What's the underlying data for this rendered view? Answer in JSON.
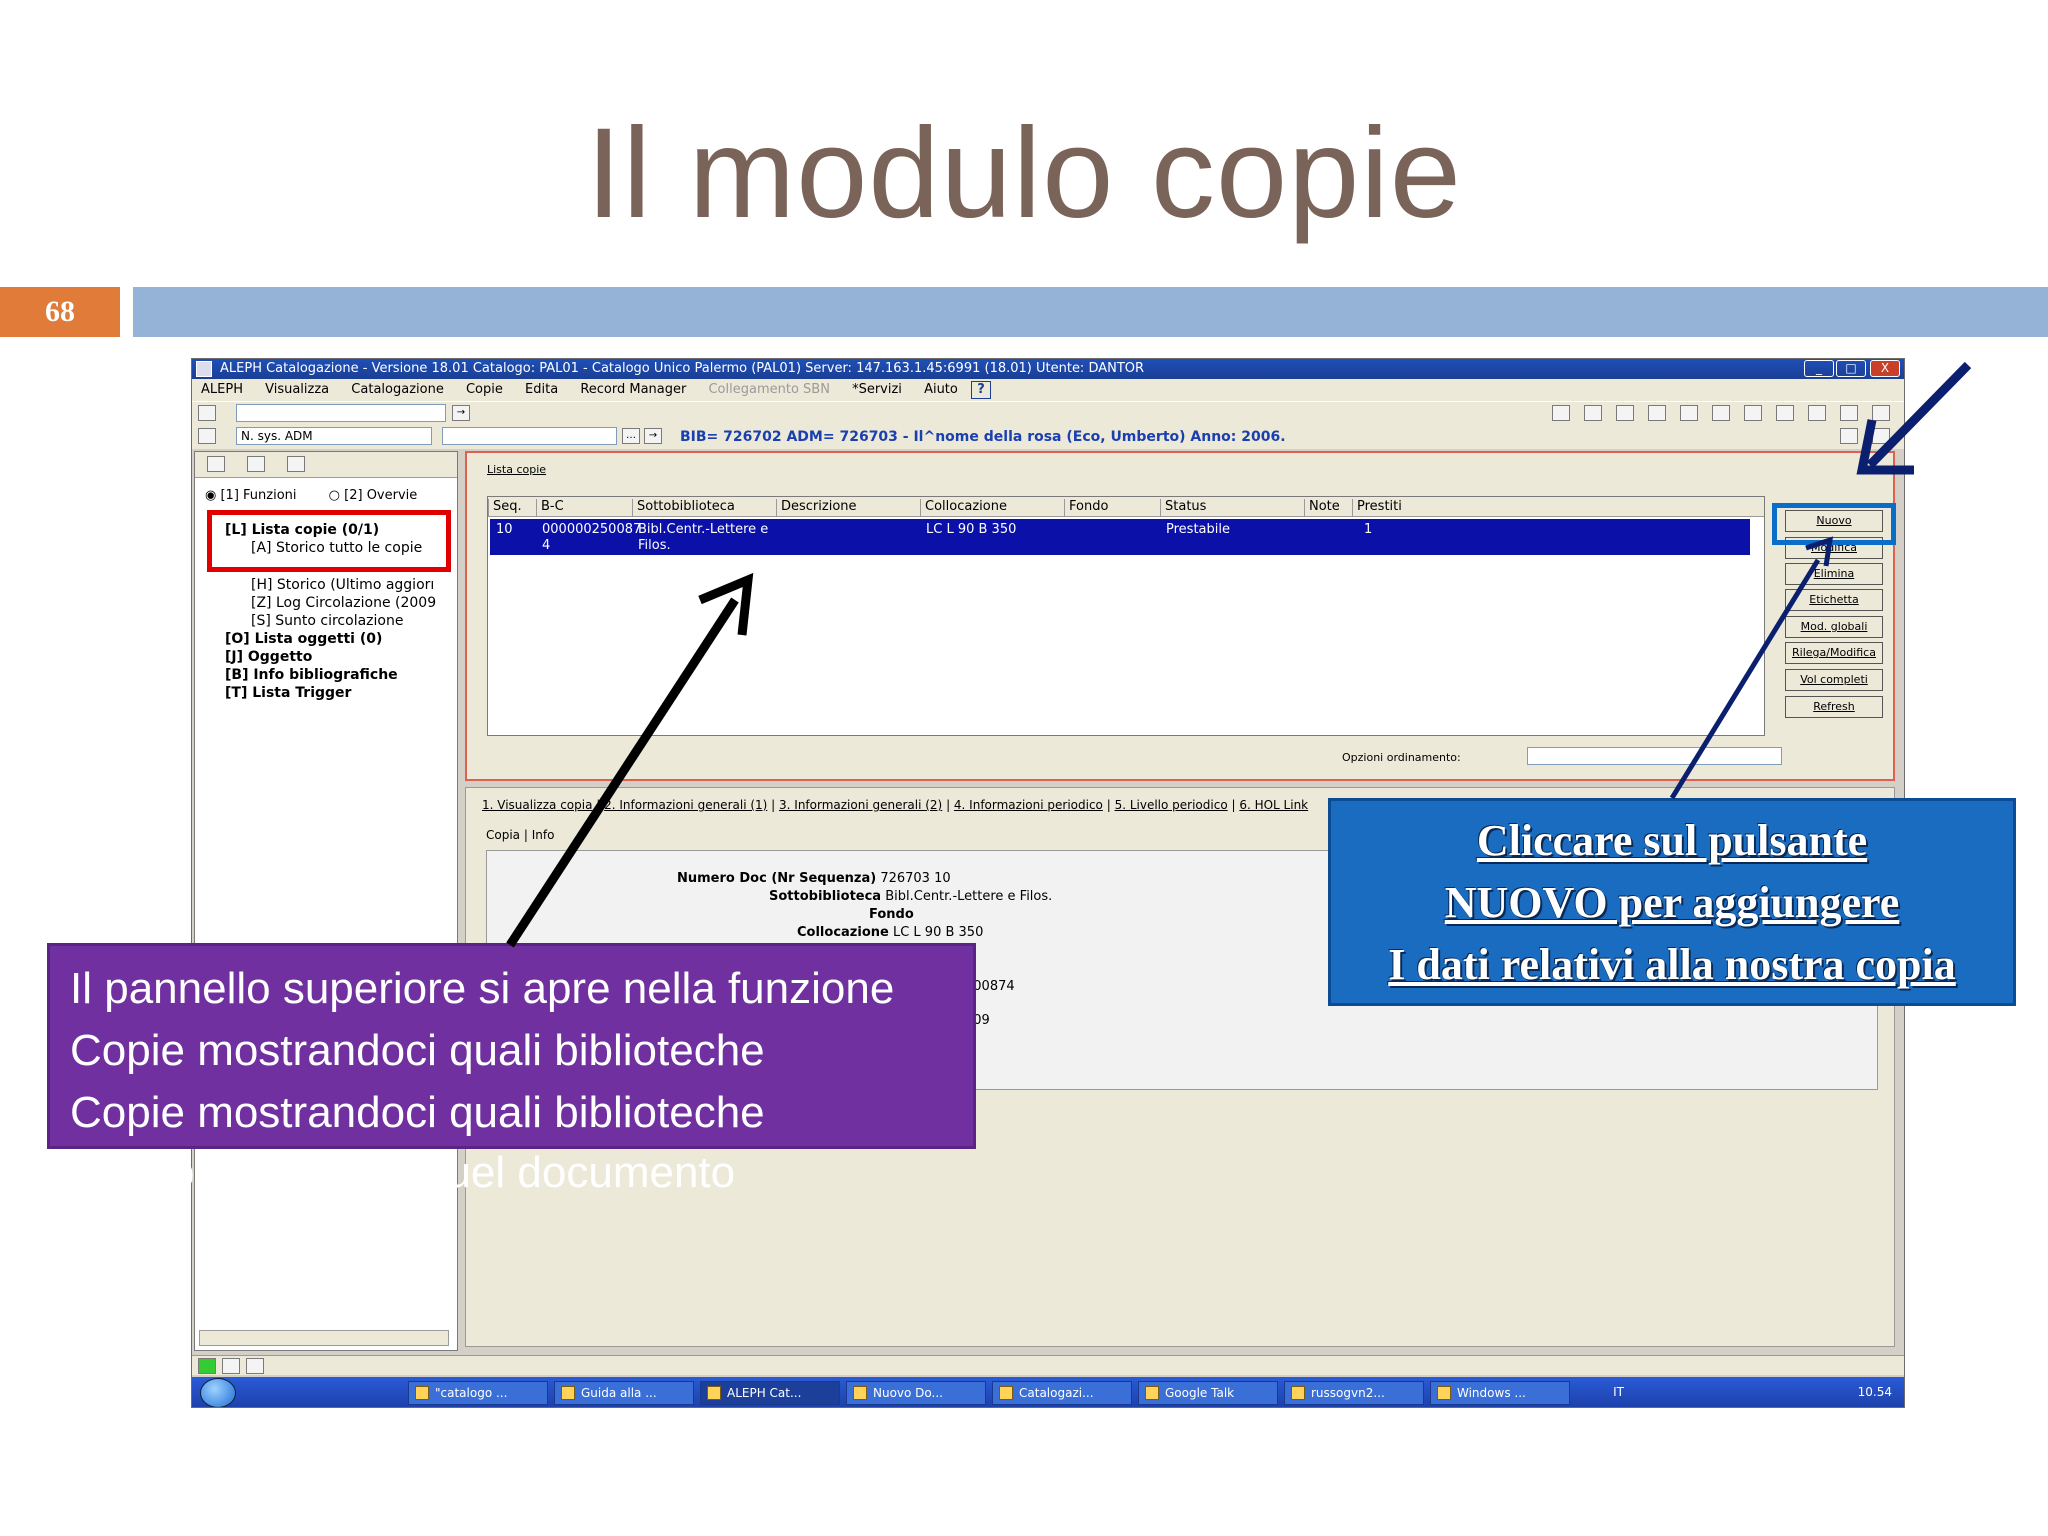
{
  "slide": {
    "title": "Il modulo copie",
    "number": "68"
  },
  "window": {
    "title": "ALEPH Catalogazione - Versione 18.01  Catalogo:  PAL01 - Catalogo Unico Palermo (PAL01)  Server:  147.163.1.45:6991 (18.01)  Utente:  DANTOR",
    "controls": [
      "_",
      "□",
      "X"
    ]
  },
  "menu": [
    "ALEPH",
    "Visualizza",
    "Catalogazione",
    "Copie",
    "Edita",
    "Record Manager",
    "Collegamento SBN",
    "*Servizi",
    "Aiuto"
  ],
  "menu_help": "?",
  "toolbar": {
    "sys_select": "N. sys. ADM",
    "bib_line": "BIB= 726702 ADM= 726703 - Il^nome della rosa (Eco, Umberto) Anno: 2006."
  },
  "left_panel": {
    "radio_funzioni": "[1] Funzioni",
    "radio_overview": "[2] Overvie",
    "tree": [
      {
        "label": "[L] Lista copie (0/1)",
        "bold": true
      },
      {
        "label": "[A] Storico tutto le copie",
        "bold": false
      },
      {
        "label": "[H] Storico (Ultimo aggiorı",
        "bold": false
      },
      {
        "label": "[Z] Log Circolazione (2009",
        "bold": false
      },
      {
        "label": "[S] Sunto circolazione",
        "bold": false
      },
      {
        "label": "[O] Lista oggetti (0)",
        "bold": true
      },
      {
        "label": "[J] Oggetto",
        "bold": true
      },
      {
        "label": "[B] Info bibliografiche",
        "bold": true
      },
      {
        "label": "[T] Lista Trigger",
        "bold": true
      }
    ]
  },
  "upper_panel": {
    "tab": "Lista copie",
    "columns": [
      "Seq.",
      "B-C",
      "Sottobiblioteca",
      "Descrizione",
      "Collocazione",
      "Fondo",
      "Status",
      "Note",
      "Prestiti"
    ],
    "row": {
      "seq": "10",
      "bc": "000000250087 4",
      "sottobiblioteca": "Bibl.Centr.-Lettere e Filos.",
      "descrizione": "",
      "collocazione": "LC L 90 B 350",
      "fondo": "",
      "status": "Prestabile",
      "note": "",
      "prestiti": "1"
    },
    "buttons": [
      "Nuovo",
      "Modifica",
      "Elimina",
      "Etichetta",
      "Mod. globali",
      "Rilega/Modifica",
      "Vol completi",
      "Refresh"
    ],
    "sort_label": "Opzioni ordinamento:"
  },
  "lower_panel": {
    "tabs": [
      "1. Visualizza copia",
      "2. Informazioni generali (1)",
      "3. Informazioni generali (2)",
      "4. Informazioni periodico",
      "5. Livello periodico",
      "6. HOL Link"
    ],
    "sub_tabs": [
      "Copia",
      "Info"
    ],
    "detail": [
      {
        "label": "Numero Doc (Nr Sequenza)",
        "value": "726703 10"
      },
      {
        "label": "Sottobiblioteca",
        "value": "Bibl.Centr.-Lettere e Filos."
      },
      {
        "label": "Fondo",
        "value": ""
      },
      {
        "label": "Collocazione",
        "value": "LC L 90 B 350"
      }
    ],
    "partial_values": [
      "e",
      "500874",
      "009"
    ]
  },
  "taskbar": {
    "items": [
      "\"catalogo ...",
      "Guida alla ...",
      "ALEPH Cat...",
      "Nuovo Do...",
      "Catalogazi...",
      "Google Talk",
      "russogvn2...",
      "Windows ..."
    ],
    "lang": "IT",
    "clock": "10.54"
  },
  "callouts": {
    "purple_lines": [
      "Il pannello superiore si apre nella funzione",
      "Copie mostrandoci quali  biblioteche",
      "Copie mostrandoci quali biblioteche"
    ],
    "purple_overflow": "posseggono quel documento",
    "blue_lines": [
      "Cliccare sul pulsante",
      "NUOVO per aggiungere",
      "I dati relativi alla nostra copia"
    ]
  },
  "colors": {
    "title": "#7a6358",
    "slide_number_bg": "#e07b39",
    "band": "#95b3d7",
    "selected_row": "#0b10a8",
    "highlight_red": "#e00000",
    "callout_purple": "#7030a0",
    "callout_blue": "#1a6cc0"
  }
}
